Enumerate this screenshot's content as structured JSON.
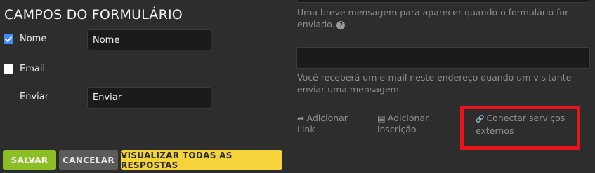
{
  "form_fields": {
    "section_title": "CAMPOS DO FORMULÁRIO",
    "fields": [
      {
        "label": "Nome",
        "checked": true,
        "value": "Nome"
      },
      {
        "label": "Email",
        "checked": false
      },
      {
        "label": "Enviar",
        "value": "Enviar"
      }
    ]
  },
  "settings": {
    "success_message_help": "Uma breve mensagem para aparecer quando o formulário for enviado.",
    "email_help": "Você receberá um e-mail neste endereço quando um visitante enviar uma mensagem."
  },
  "actions": [
    {
      "icon": "share-arrow-icon",
      "glyph": "➦",
      "label": "Adicionar Link"
    },
    {
      "icon": "list-icon",
      "glyph": "▤",
      "label": "Adicionar inscrição"
    },
    {
      "icon": "link-icon",
      "glyph": "🔗",
      "label": "Conectar serviços externos"
    }
  ],
  "buttons": {
    "save": "SALVAR",
    "cancel": "CANCELAR",
    "view_all": "VISUALIZAR TODAS AS RESPOSTAS"
  },
  "colors": {
    "background": "#2d2d2d",
    "save": "#8cbf26",
    "cancel": "#5b5b5b",
    "view_all": "#f5d43b",
    "checkbox": "#3d8bff",
    "highlight": "#e8141b"
  }
}
